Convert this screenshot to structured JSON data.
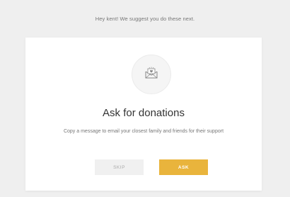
{
  "header": {
    "suggestion": "Hey kent! We suggest you do these next."
  },
  "card": {
    "icon": "envelope-heart-icon",
    "title": "Ask for donations",
    "description": "Copy a message to email your closest family and friends for their support"
  },
  "actions": {
    "skip_label": "SKIP",
    "ask_label": "ASK"
  },
  "colors": {
    "accent": "#e9b43c",
    "background": "#efefef",
    "card": "#ffffff"
  }
}
